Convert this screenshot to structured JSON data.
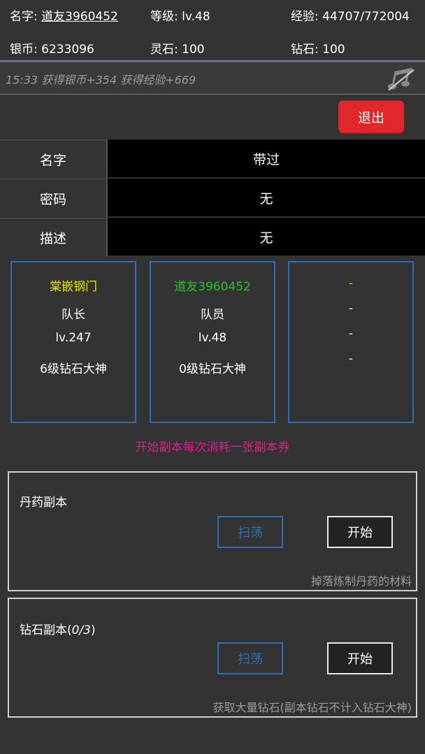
{
  "header": {
    "name_label": "名字: ",
    "name_value": "道友3960452",
    "level": "等级: lv.48",
    "exp": "经验: 44707/772004",
    "silver": "银币: 6233096",
    "spirit_stone": "灵石: 100",
    "diamond": "钻石: 100"
  },
  "log": {
    "text": "15:33 获得银币+354 获得经验+669"
  },
  "exit_label": "退出",
  "team_info": [
    {
      "label": "名字",
      "value": "带过"
    },
    {
      "label": "密码",
      "value": "无"
    },
    {
      "label": "描述",
      "value": "无"
    }
  ],
  "members": [
    {
      "name": "棠嵌钢门",
      "role": "队长",
      "level": "lv.247",
      "title": "6级钻石大神",
      "name_color": "#e6e600"
    },
    {
      "name": "道友3960452",
      "role": "队员",
      "level": "lv.48",
      "title": "0级钻石大神",
      "name_color": "#22c322"
    },
    {
      "name": "-",
      "role": "-",
      "level": "-",
      "title": "-",
      "name_color": "#e6c300"
    }
  ],
  "notice": "开始副本每次消耗一张副本券",
  "dungeons": [
    {
      "title": "丹药副本",
      "count": "",
      "sweep_label": "扫荡",
      "start_label": "开始",
      "desc": "掉落炼制丹药的材料"
    },
    {
      "title": "钻石副本(",
      "count": "0/3",
      "count_close": ")",
      "sweep_label": "扫荡",
      "start_label": "开始",
      "desc": "获取大量钻石(副本钻石不计入钻石大神)"
    }
  ],
  "colors": {
    "accent_blue": "#2f6fb4",
    "exit_red": "#e0272b",
    "notice_pink": "#d91f8a"
  },
  "icons": {
    "music": "music-off-icon"
  }
}
